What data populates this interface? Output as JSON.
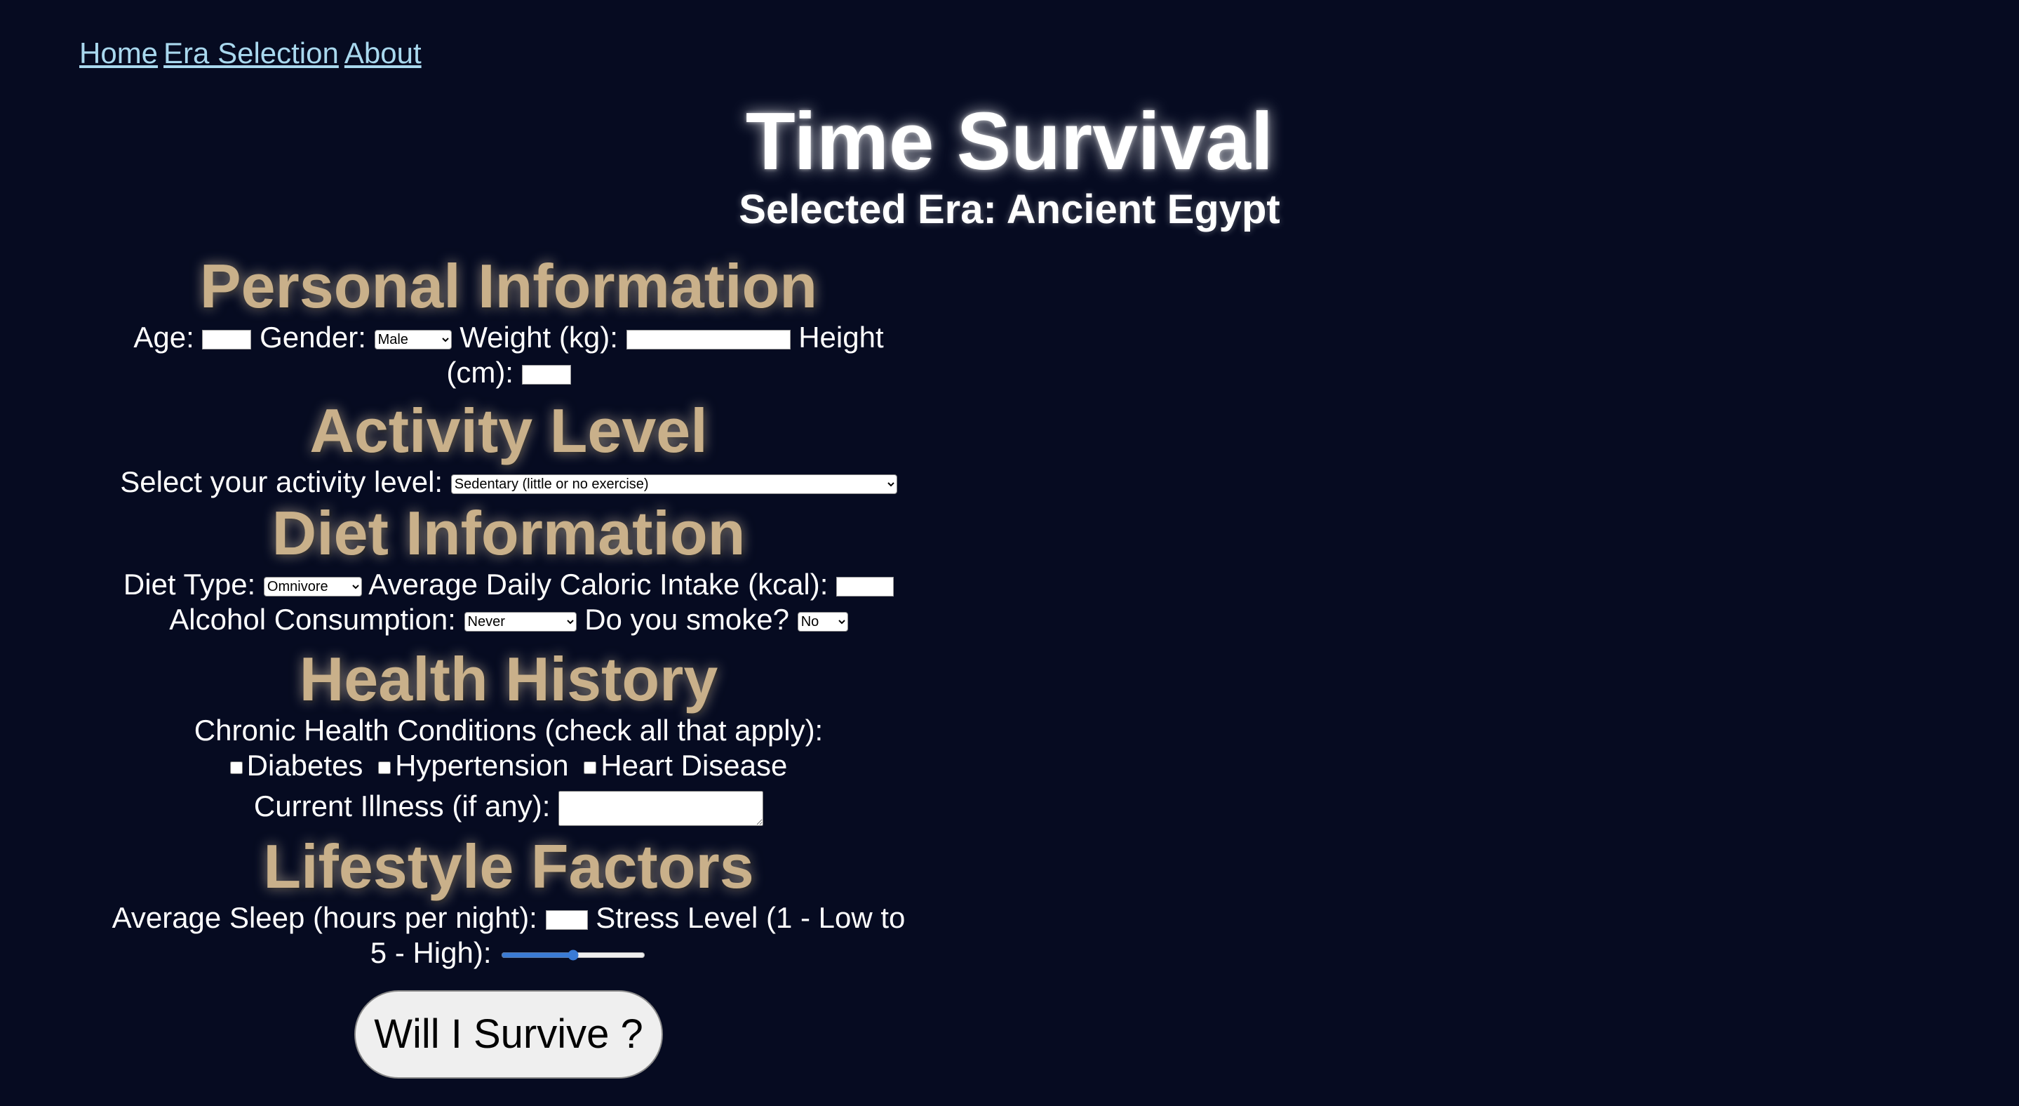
{
  "nav": {
    "home": "Home",
    "era_selection": "Era Selection",
    "about": "About"
  },
  "header": {
    "title": "Time Survival",
    "selected_era": "Selected Era: Ancient Egypt"
  },
  "personal": {
    "heading": "Personal Information",
    "age_label": "Age:",
    "gender_label": "Gender:",
    "gender_value": "Male",
    "weight_label": "Weight (kg):",
    "height_label_1": "Height",
    "height_label_2": "(cm):"
  },
  "activity": {
    "heading": "Activity Level",
    "label": "Select your activity level:",
    "value": "Sedentary (little or no exercise)"
  },
  "diet": {
    "heading": "Diet Information",
    "type_label": "Diet Type:",
    "type_value": "Omnivore",
    "calories_label": "Average Daily Caloric Intake (kcal):",
    "alcohol_label": "Alcohol Consumption:",
    "alcohol_value": "Never",
    "smoke_label": "Do you smoke?",
    "smoke_value": "No"
  },
  "health": {
    "heading": "Health History",
    "chronic_label": "Chronic Health Conditions (check all that apply):",
    "conditions": [
      "Diabetes",
      "Hypertension",
      "Heart Disease"
    ],
    "illness_label": "Current Illness (if any):"
  },
  "lifestyle": {
    "heading": "Lifestyle Factors",
    "sleep_label": "Average Sleep (hours per night):",
    "stress_label_1": "Stress Level (1 - Low to",
    "stress_label_2": "5 - High):",
    "stress_value": 3
  },
  "submit_label": "Will I Survive ?"
}
